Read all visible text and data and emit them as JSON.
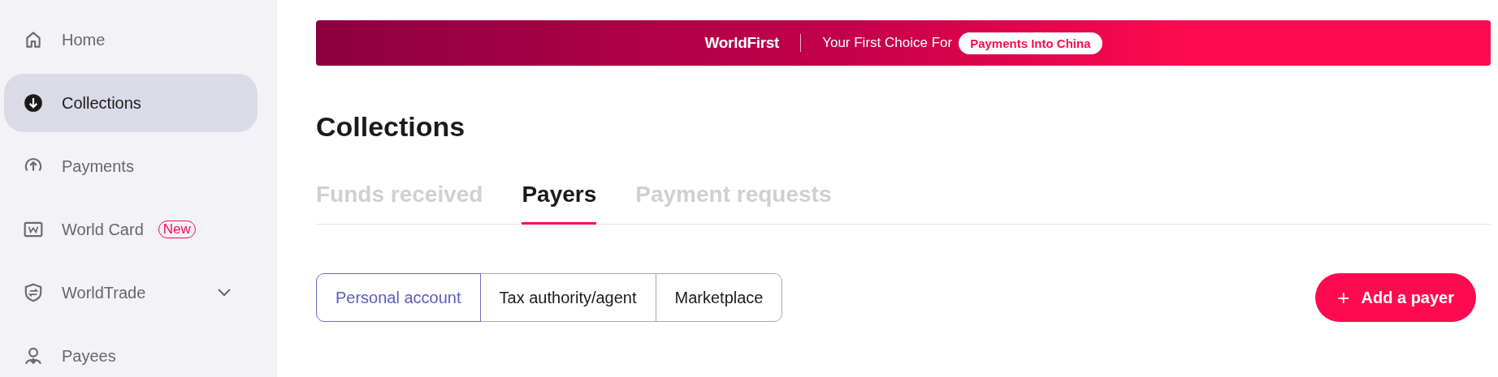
{
  "sidebar": {
    "items": [
      {
        "label": "Home",
        "selected": false
      },
      {
        "label": "Collections",
        "selected": true
      },
      {
        "label": "Payments",
        "selected": false
      },
      {
        "label": "World Card",
        "selected": false,
        "badge": "New"
      },
      {
        "label": "WorldTrade",
        "selected": false,
        "expanded": false
      },
      {
        "label": "Payees",
        "selected": false
      }
    ]
  },
  "banner": {
    "logo": "WorldFirst",
    "tagline": "Your First Choice For",
    "pill": "Payments Into China"
  },
  "page_title": "Collections",
  "tabs": [
    {
      "label": "Funds received",
      "selected": false
    },
    {
      "label": "Payers",
      "selected": true
    },
    {
      "label": "Payment requests",
      "selected": false
    }
  ],
  "segments": [
    {
      "label": "Personal account",
      "selected": true
    },
    {
      "label": "Tax authority/agent",
      "selected": false
    },
    {
      "label": "Marketplace",
      "selected": false
    }
  ],
  "add_button": {
    "icon": "+",
    "label": "Add a payer"
  }
}
